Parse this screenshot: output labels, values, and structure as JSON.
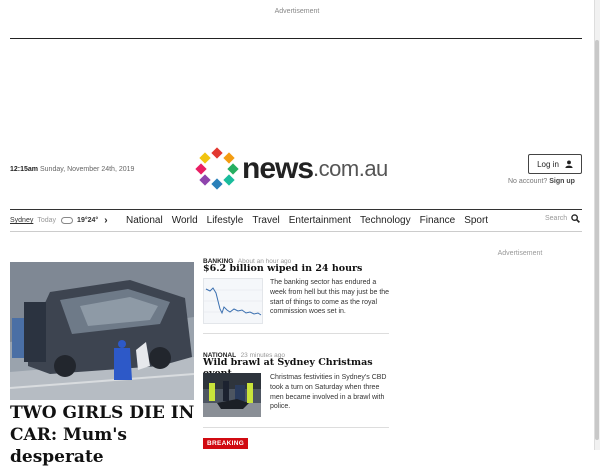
{
  "ad_top_label": "Advertisement",
  "header": {
    "time": "12:15am",
    "date": "Sunday, November 24th, 2019",
    "logo_word": "news",
    "logo_tld": ".com.au",
    "login_label": "Log in",
    "no_account": "No account?",
    "signup_label": "Sign up"
  },
  "weather": {
    "location": "Sydney",
    "today": "Today",
    "temps": "19°24°"
  },
  "nav": {
    "links": [
      "National",
      "World",
      "Lifestyle",
      "Travel",
      "Entertainment",
      "Technology",
      "Finance",
      "Sport"
    ],
    "search_label": "Search"
  },
  "hero": {
    "title": "TWO GIRLS DIE IN CAR: Mum's desperate"
  },
  "stories": [
    {
      "category": "BANKING",
      "time": "About an hour ago",
      "headline": "$6.2 billion wiped in 24 hours",
      "summary": "The banking sector has endured a week from hell but this may just be the start of things to come as the royal commission woes set in."
    },
    {
      "category": "NATIONAL",
      "time": "23 minutes ago",
      "headline": "Wild brawl at Sydney Christmas event",
      "summary": "Christmas festivities in Sydney's CBD took a turn on Saturday when three men became involved in a brawl with police."
    }
  ],
  "ad_side_label": "Advertisement",
  "breaking_label": "BREAKING",
  "colors": {
    "breaking": "#d10a11",
    "logo_dots": [
      "#e2382f",
      "#f39c12",
      "#27ae60",
      "#2980b9",
      "#8e44ad",
      "#e91e63",
      "#1abc9c",
      "#f1c40f"
    ]
  }
}
